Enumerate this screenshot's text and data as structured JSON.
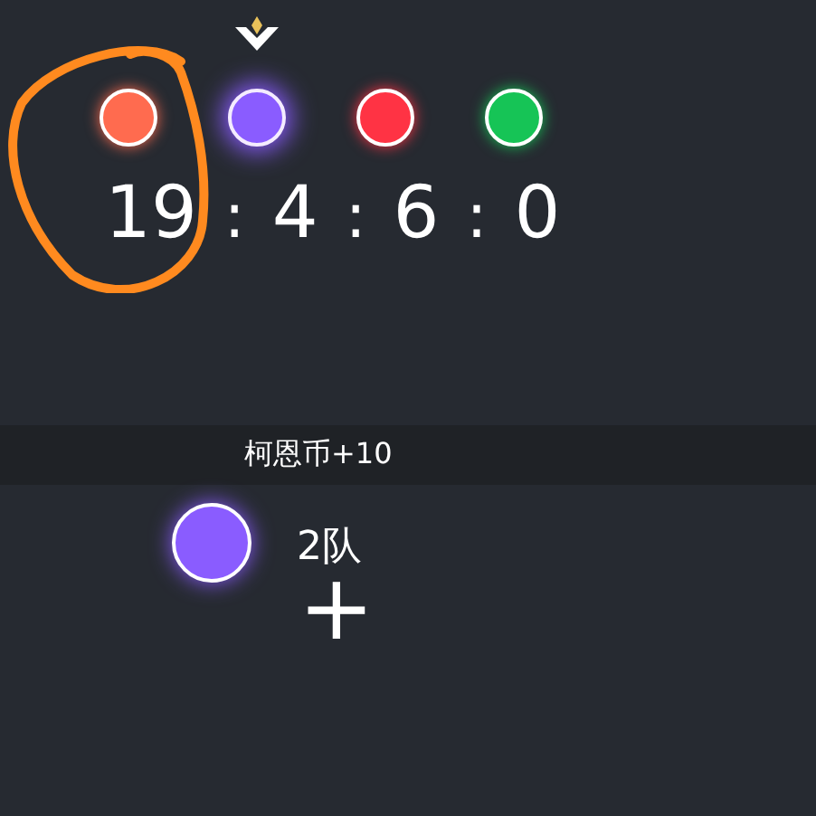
{
  "teams": [
    {
      "color": "#ff6b4f",
      "selected": false
    },
    {
      "color": "#8a5cff",
      "selected": true
    },
    {
      "color": "#ff3344",
      "selected": false
    },
    {
      "color": "#16c456",
      "selected": false
    }
  ],
  "score_parts": [
    "19",
    ":",
    "4",
    ":",
    "6",
    ":",
    "0"
  ],
  "notice": "柯恩币+10",
  "current_team": {
    "color": "#8a5cff",
    "label": "2队",
    "add_symbol": "+"
  }
}
